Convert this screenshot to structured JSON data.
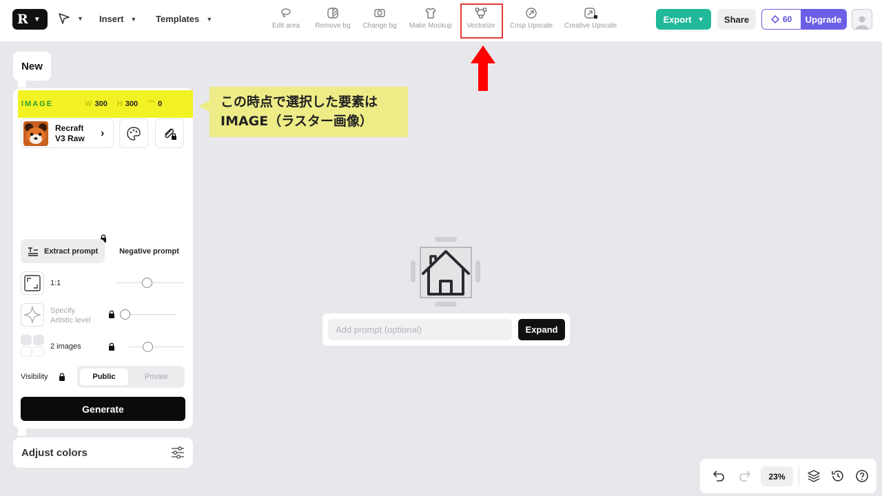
{
  "topbar": {
    "menus": {
      "insert": "Insert",
      "templates": "Templates"
    },
    "tools": [
      {
        "label": "Edit area",
        "icon": "lasso-icon"
      },
      {
        "label": "Remove bg",
        "icon": "remove-bg-icon"
      },
      {
        "label": "Change bg",
        "icon": "change-bg-icon"
      },
      {
        "label": "Make Mockup",
        "icon": "tshirt-icon"
      },
      {
        "label": "Vectorize",
        "icon": "vector-nodes-icon",
        "highlighted": true
      },
      {
        "label": "Crisp Upscale",
        "icon": "upscale-icon"
      },
      {
        "label": "Creative Upscale",
        "icon": "creative-upscale-icon"
      }
    ],
    "export_label": "Export",
    "share_label": "Share",
    "credits": "60",
    "upgrade_label": "Upgrade",
    "colors": {
      "export": "#22b99a",
      "upgrade": "#6b5fe6",
      "highlight_frame": "#e53935"
    }
  },
  "panel": {
    "tab_label": "New",
    "selection": {
      "type": "IMAGE",
      "w_label": "W",
      "w": "300",
      "h_label": "H",
      "h": "300",
      "rotation": "0"
    },
    "model": {
      "name_line1": "Recraft",
      "name_line2": "V3 Raw"
    },
    "extract_prompt": "Extract prompt",
    "negative_prompt": "Negative prompt",
    "aspect_ratio": "1:1",
    "artistic_level_line1": "Specify",
    "artistic_level_line2": "Artistic level",
    "image_count": "2 images",
    "visibility_label": "Visibility",
    "visibility_public": "Public",
    "visibility_private": "Private",
    "generate_label": "Generate",
    "adjust_colors": "Adjust colors"
  },
  "callout": {
    "line1": "この時点で選択した要素は",
    "line2": "IMAGE（ラスター画像）"
  },
  "canvas": {
    "prompt_placeholder": "Add prompt (optional)",
    "expand_label": "Expand"
  },
  "bottombar": {
    "zoom": "23%"
  }
}
